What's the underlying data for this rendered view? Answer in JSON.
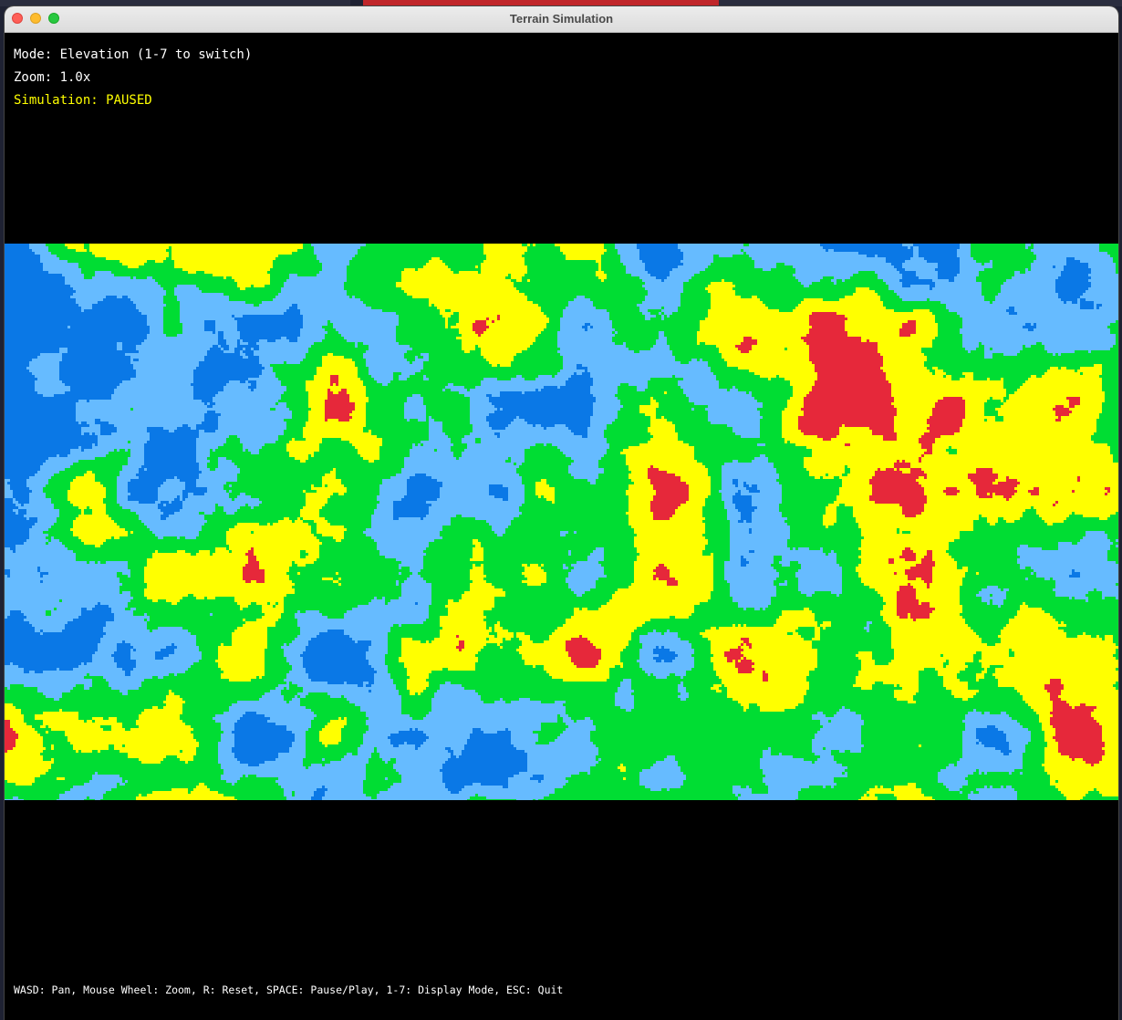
{
  "window": {
    "title": "Terrain Simulation"
  },
  "hud": {
    "mode": "Mode: Elevation (1-7 to switch)",
    "zoom": "Zoom: 1.0x",
    "simulation": "Simulation: PAUSED"
  },
  "help_text": "WASD: Pan, Mouse Wheel: Zoom, R: Reset, SPACE: Pause/Play, 1-7: Display Mode, ESC: Quit",
  "terrain": {
    "display_mode": "Elevation",
    "colors": {
      "deep_water": "#0a78e6",
      "shallow_water": "#66bbff",
      "lowland": "#00dd33",
      "highland": "#ffff00",
      "peak": "#e6283a"
    }
  },
  "colors": {
    "background": "#000000",
    "hud_text": "#ffffff",
    "status_text": "#ffff00"
  }
}
